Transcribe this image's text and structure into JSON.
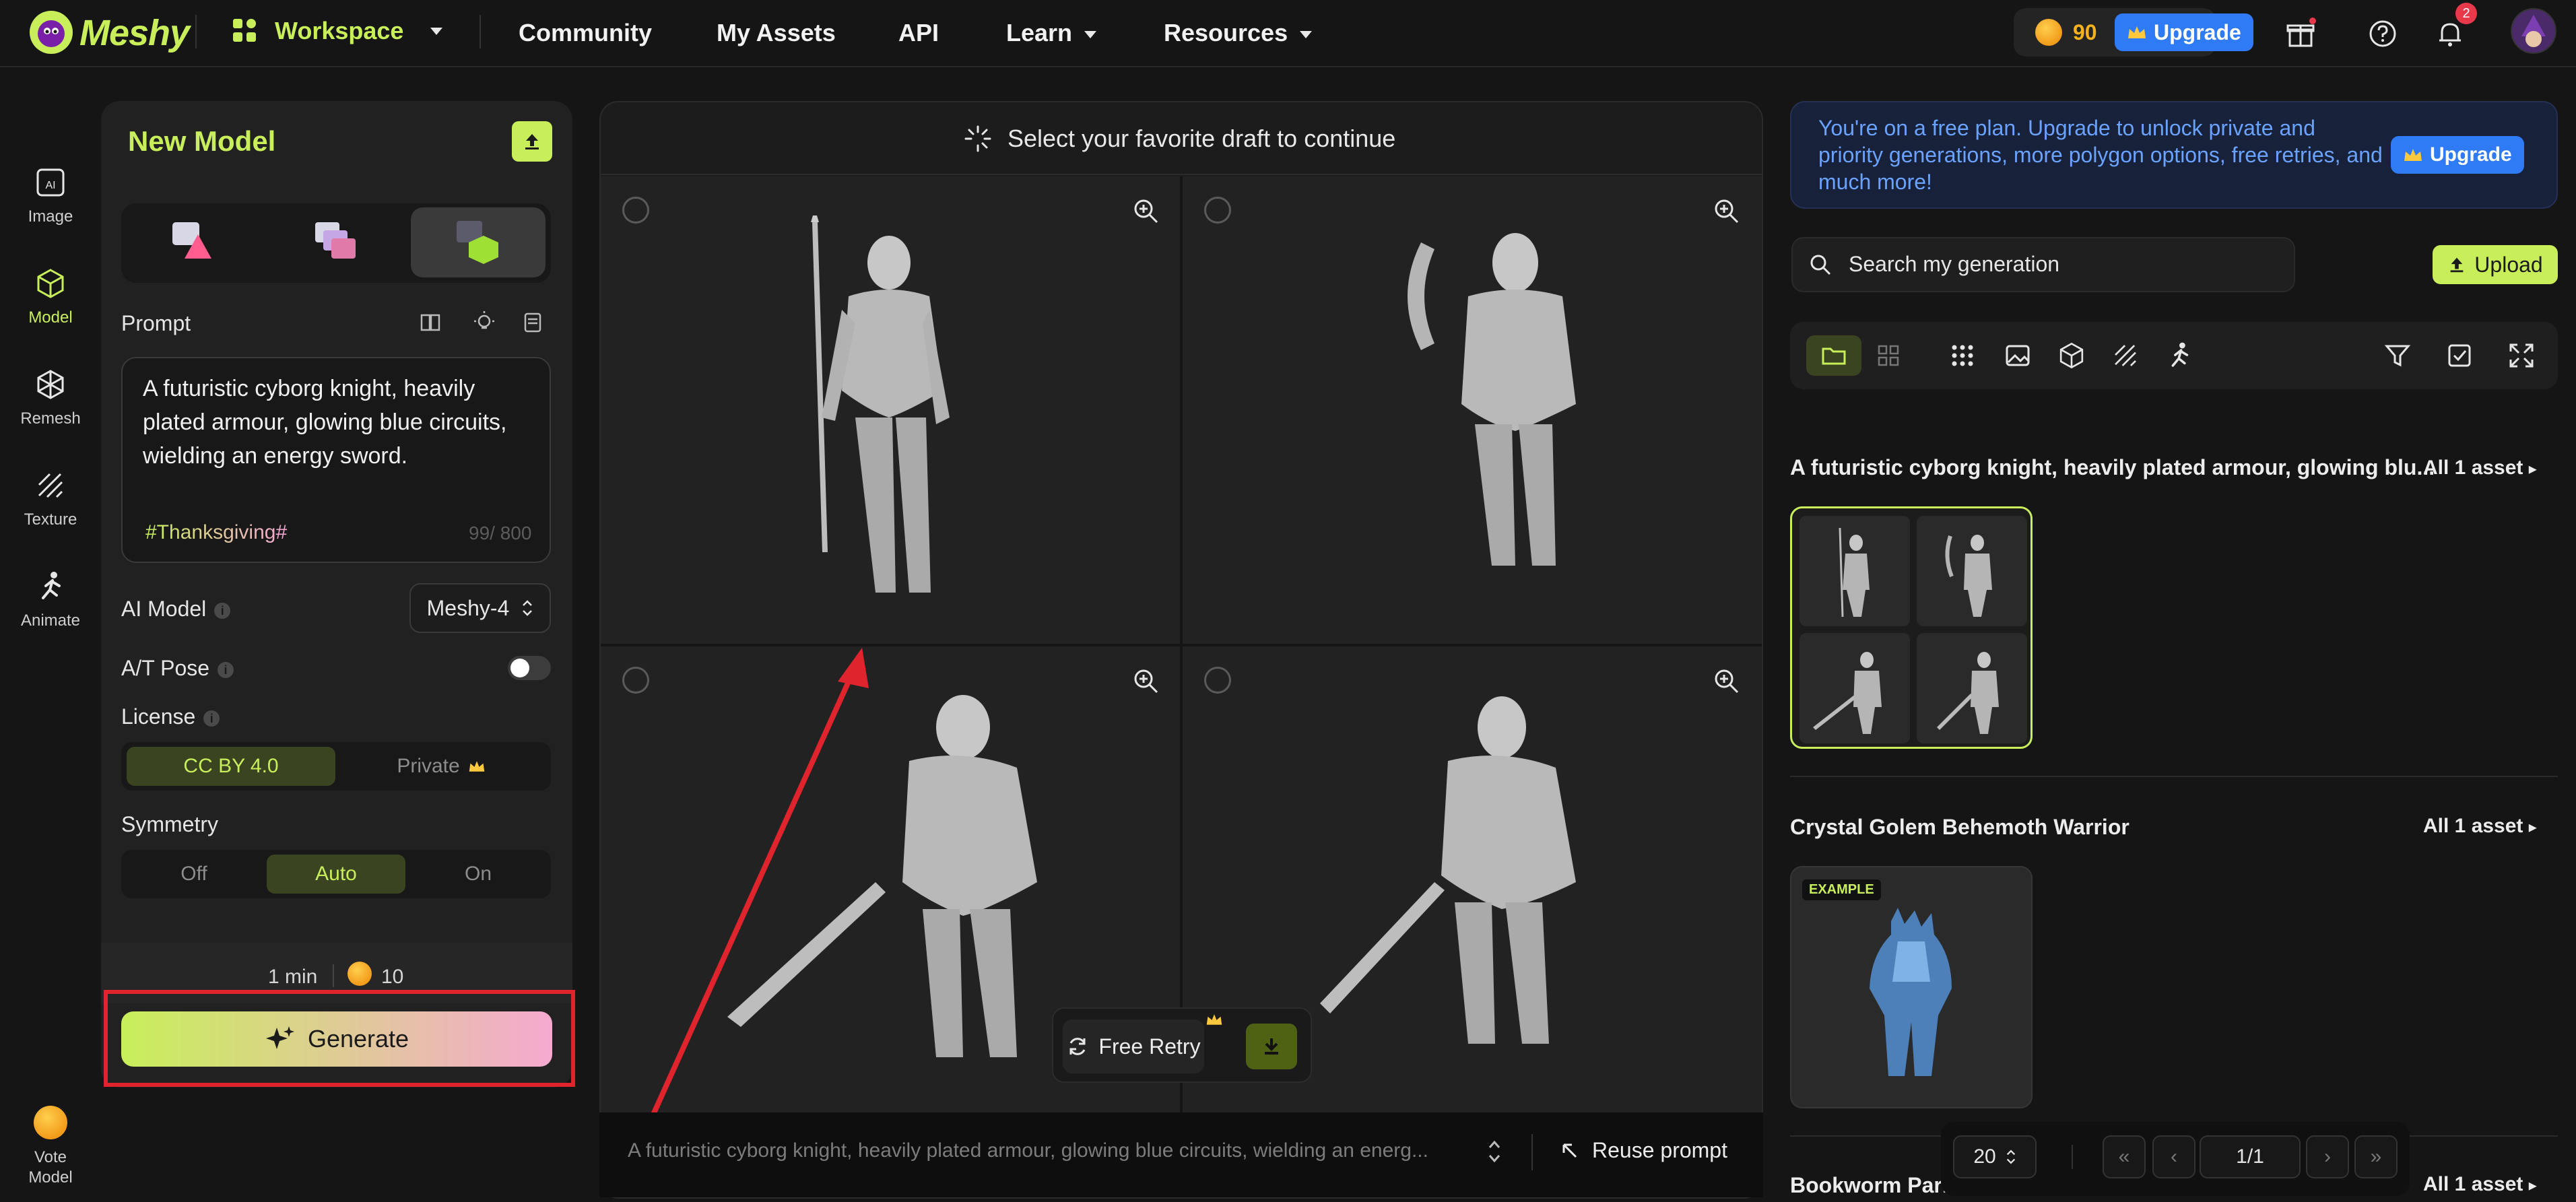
{
  "brand": {
    "name": "Meshy",
    "accent": "#c8ef5a"
  },
  "nav": {
    "workspace": "Workspace",
    "community": "Community",
    "my_assets": "My Assets",
    "api": "API",
    "learn": "Learn",
    "resources": "Resources"
  },
  "account": {
    "credits": "90",
    "upgrade_label": "Upgrade",
    "notification_count": "2"
  },
  "rail": {
    "image": "Image",
    "model": "Model",
    "remesh": "Remesh",
    "texture": "Texture",
    "animate": "Animate",
    "vote_model": "Vote Model"
  },
  "left_panel": {
    "title": "New Model",
    "prompt_label": "Prompt",
    "prompt_text": "A futuristic cyborg knight, heavily plated armour, glowing blue circuits, wielding an energy sword.",
    "hashtag": "#Thanksgiving#",
    "char_count": "99/ 800",
    "ai_model_label": "AI Model",
    "ai_model_value": "Meshy-4",
    "pose_label": "A/T Pose",
    "pose_enabled": false,
    "license_label": "License",
    "license_options": [
      "CC BY 4.0",
      "Private"
    ],
    "license_selected": "CC BY 4.0",
    "symmetry_label": "Symmetry",
    "symmetry_options": [
      "Off",
      "Auto",
      "On"
    ],
    "symmetry_selected": "Auto",
    "time_estimate": "1 min",
    "cost": "10",
    "generate_label": "Generate"
  },
  "center": {
    "header": "Select your favorite draft to continue",
    "bottom_prompt": "A futuristic cyborg knight, heavily plated armour, glowing blue circuits, wielding an energ...",
    "reuse_label": "Reuse prompt",
    "retry_label": "Free Retry"
  },
  "right_panel": {
    "promo_text": "You're on a free plan. Upgrade to unlock private and priority generations, more polygon options, free retries, and much more!",
    "promo_upgrade": "Upgrade",
    "search_placeholder": "Search my generation",
    "upload_label": "Upload",
    "groups": [
      {
        "title": "A futuristic cyborg knight, heavily plated armour, glowing blu...",
        "count": "All 1 asset"
      },
      {
        "title": "Crystal Golem Behemoth Warrior",
        "count": "All 1 asset",
        "tag": "EXAMPLE"
      },
      {
        "title": "Bookworm Parro",
        "count": "All 1 asset"
      }
    ],
    "pager": {
      "page_size": "20",
      "page": "1/1"
    }
  }
}
